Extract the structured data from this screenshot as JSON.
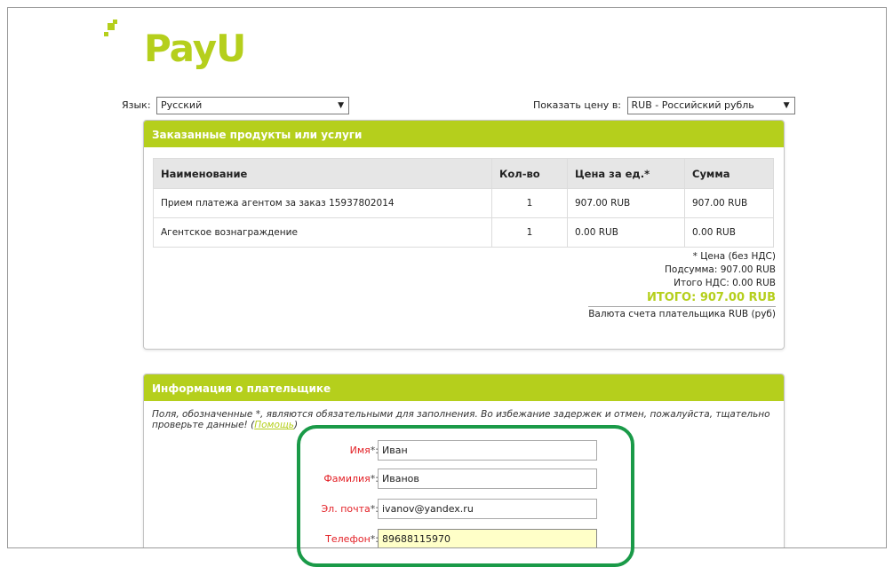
{
  "brand": {
    "logo_text_left": "Pay",
    "logo_text_right": "U",
    "accent_color": "#b5cf1c"
  },
  "language_selector": {
    "label": "Язык:",
    "selected": "Русский"
  },
  "currency_selector": {
    "label": "Показать цену в:",
    "selected": "RUB - Российский рубль"
  },
  "order_panel": {
    "title": "Заказанные продукты или услуги",
    "columns": [
      "Наименование",
      "Кол-во",
      "Цена за ед.*",
      "Сумма"
    ],
    "rows": [
      {
        "name": "Прием платежа агентом за заказ 15937802014",
        "qty": "1",
        "price": "907.00 RUB",
        "sum": "907.00 RUB"
      },
      {
        "name": "Агентское вознаграждение",
        "qty": "1",
        "price": "0.00 RUB",
        "sum": "0.00 RUB"
      }
    ],
    "price_note": "* Цена (без НДС)",
    "subtotal": "Подсумма: 907.00 RUB",
    "vat_total": "Итого НДС: 0.00 RUB",
    "grand_total": "ИТОГО: 907.00 RUB",
    "payer_currency": "Валюта счета плательщика RUB (руб)"
  },
  "payer_panel": {
    "title": "Информация о плательщике",
    "note": "Поля, обозначенные *, являются обязательными для заполнения. Во избежание задержек и отмен, пожалуйста, тщательно проверьте данные!",
    "help_link": "Помощь",
    "fields": [
      {
        "label": "Имя",
        "value": "Иван"
      },
      {
        "label": "Фамилия",
        "value": "Иванов"
      },
      {
        "label": "Эл. почта",
        "value": "ivanov@yandex.ru"
      },
      {
        "label": "Телефон",
        "value": "89688115970"
      }
    ],
    "required_mark": "*:",
    "highlight_color": "#1a9a48"
  }
}
